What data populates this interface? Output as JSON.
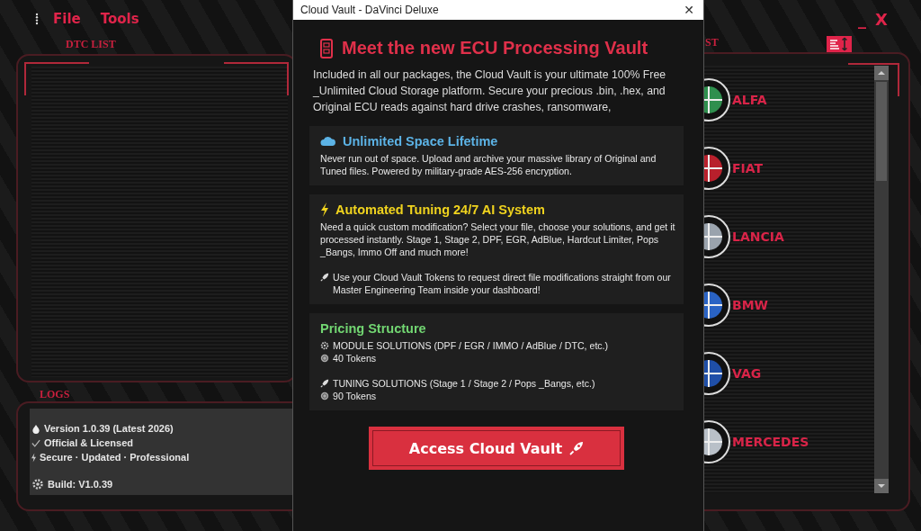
{
  "menu": [
    {
      "label": "File"
    },
    {
      "label": "Tools"
    }
  ],
  "window_controls": [
    "_",
    "X"
  ],
  "dtc_list": {
    "title": "DTC LIST"
  },
  "logs": {
    "title": "LOGS",
    "groups": [
      [
        {
          "kind": "drop",
          "text": "Version 1.0.39 (Latest 2026)"
        },
        {
          "kind": "check",
          "text": "Official & Licensed"
        },
        {
          "kind": "bolt",
          "text": "Secure · Updated · Professional"
        }
      ],
      [
        {
          "kind": "gear",
          "text": "Build: V1.0.39"
        }
      ]
    ]
  },
  "brand_list": {
    "title": "ST",
    "items": [
      {
        "name": "ALFA",
        "color": "#2f8f4e"
      },
      {
        "name": "FIAT",
        "color": "#b8202c"
      },
      {
        "name": "LANCIA",
        "color": "#9aa3ad"
      },
      {
        "name": "BMW",
        "color": "#2a63c4"
      },
      {
        "name": "VAG",
        "color": "#1f4fa8"
      },
      {
        "name": "MERCEDES",
        "color": "#b9c0c8"
      }
    ]
  },
  "dialog": {
    "title": "Cloud Vault - DaVinci Deluxe",
    "close": "✕",
    "heading": "Meet the new ECU Processing Vault",
    "intro": "Included in all our packages, the Cloud Vault is your ultimate 100% Free _Unlimited Cloud Storage platform. Secure your precious .bin, .hex, and Original ECU reads against hard drive crashes, ransomware,",
    "sections": [
      {
        "kind": "cloud",
        "title": "Unlimited Space Lifetime",
        "color": "#5cb3e6",
        "groups": [
          [
            {
              "text": "Never run out of space. Upload and archive your massive library of Original and Tuned files. Powered by military-grade AES-256 encryption."
            }
          ]
        ]
      },
      {
        "kind": "bolt",
        "title": "Automated Tuning 24/7 AI System",
        "color": "#f0d31e",
        "groups": [
          [
            {
              "text": "Need a quick custom modification? Select your file, choose your solutions, and get it processed instantly. Stage 1, Stage 2, DPF, EGR, AdBlue, Hardcut Limiter, Pops _Bangs, Immo Off and much more!"
            }
          ],
          [
            {
              "kind": "rocket",
              "text": "Use your Cloud Vault Tokens to request direct file modifications straight from our Master Engineering Team inside your dashboard!"
            }
          ]
        ]
      },
      {
        "title": "Pricing Structure",
        "color": "#72d672",
        "groups": [
          [
            {
              "kind": "gear",
              "text": "MODULE SOLUTIONS (DPF / EGR / IMMO / AdBlue / DTC, etc.)"
            },
            {
              "kind": "coin",
              "text": "40 Tokens"
            }
          ],
          [
            {
              "kind": "rocket",
              "text": "TUNING SOLUTIONS (Stage 1 / Stage 2 / Pops _Bangs, etc.)"
            },
            {
              "kind": "coin",
              "text": "90 Tokens"
            }
          ]
        ]
      }
    ],
    "button": {
      "label": "Access Cloud Vault",
      "kind": "rocket"
    }
  }
}
